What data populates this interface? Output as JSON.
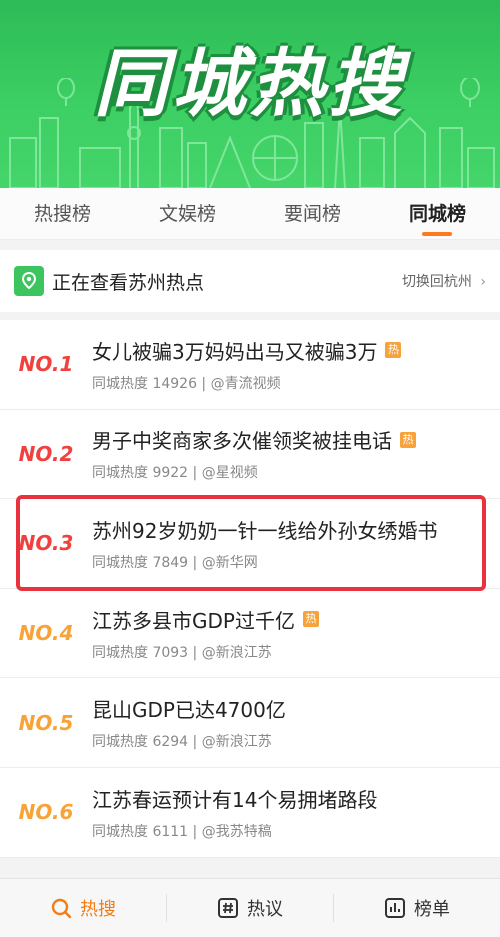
{
  "banner": {
    "title": "同城热搜"
  },
  "tabs": [
    {
      "label": "热搜榜",
      "active": false
    },
    {
      "label": "文娱榜",
      "active": false
    },
    {
      "label": "要闻榜",
      "active": false
    },
    {
      "label": "同城榜",
      "active": true
    }
  ],
  "location": {
    "viewing_text": "正在查看苏州热点",
    "switch_text": "切换回杭州"
  },
  "list": [
    {
      "rank": "NO.1",
      "title": "女儿被骗3万妈妈出马又被骗3万",
      "meta": "同城热度 14926 | @青流视频",
      "hot": true
    },
    {
      "rank": "NO.2",
      "title": "男子中奖商家多次催领奖被挂电话",
      "meta": "同城热度 9922 | @星视频",
      "hot": true
    },
    {
      "rank": "NO.3",
      "title": "苏州92岁奶奶一针一线给外孙女绣婚书",
      "meta": "同城热度 7849 | @新华网",
      "hot": false
    },
    {
      "rank": "NO.4",
      "title": "江苏多县市GDP过千亿",
      "meta": "同城热度 7093 | @新浪江苏",
      "hot": true
    },
    {
      "rank": "NO.5",
      "title": "昆山GDP已达4700亿",
      "meta": "同城热度 6294 | @新浪江苏",
      "hot": false
    },
    {
      "rank": "NO.6",
      "title": "江苏春运预计有14个易拥堵路段",
      "meta": "同城热度 6111 | @我苏特稿",
      "hot": false
    }
  ],
  "hot_badge": "热",
  "bottom_nav": [
    {
      "label": "热搜",
      "icon": "search-icon",
      "active": true
    },
    {
      "label": "热议",
      "icon": "hashtag-icon",
      "active": false
    },
    {
      "label": "榜单",
      "icon": "bar-chart-icon",
      "active": false
    }
  ],
  "colors": {
    "green": "#3cc45f",
    "accent": "#ff7a1e",
    "rank_top": "#f0413e",
    "rank_other": "#f8a338",
    "highlight": "#e8323d"
  }
}
